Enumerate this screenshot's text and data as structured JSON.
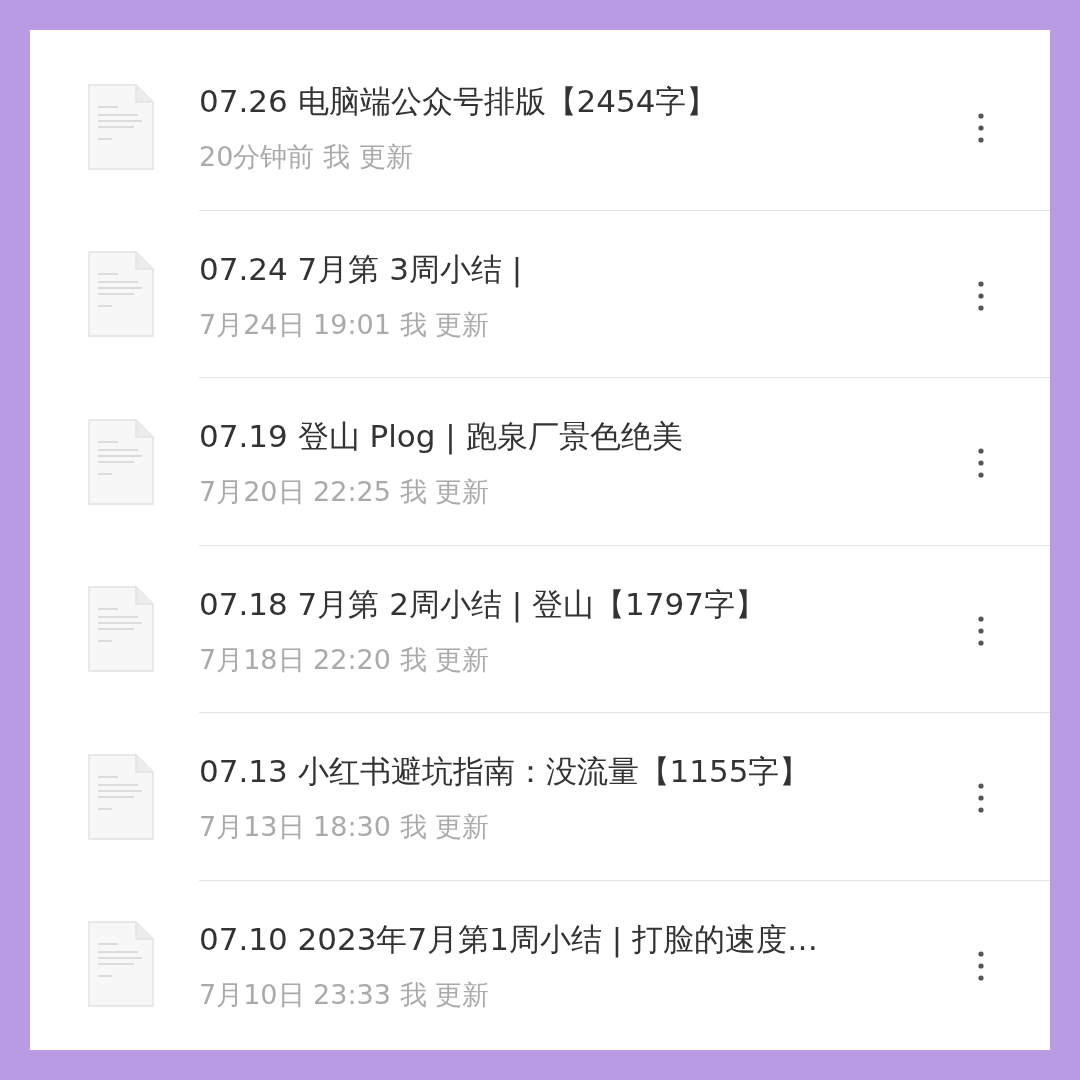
{
  "documents": [
    {
      "title": "07.26 电脑端公众号排版【2454字】",
      "meta": "20分钟前 我 更新"
    },
    {
      "title": "07.24 7月第 3周小结 |",
      "meta": "7月24日 19:01 我 更新"
    },
    {
      "title": "07.19 登山 Plog | 跑泉厂景色绝美",
      "meta": "7月20日 22:25 我 更新"
    },
    {
      "title": "07.18 7月第 2周小结 | 登山【1797字】",
      "meta": "7月18日 22:20 我 更新"
    },
    {
      "title": "07.13 小红书避坑指南：没流量【1155字】",
      "meta": "7月13日 18:30 我 更新"
    },
    {
      "title": "07.10 2023年7月第1周小结 | 打脸的速度…",
      "meta": "7月10日 23:33 我 更新"
    }
  ]
}
